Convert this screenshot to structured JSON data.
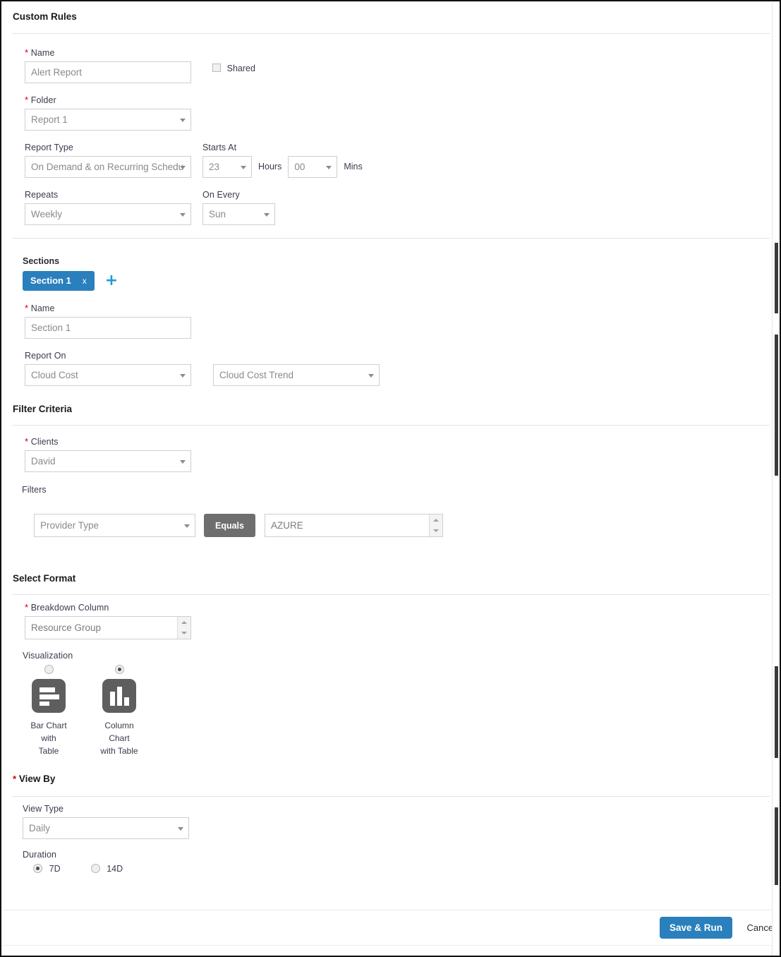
{
  "header": {
    "title": "Custom Rules"
  },
  "rule": {
    "name_label": "Name",
    "name_value": "Alert Report",
    "shared_label": "Shared",
    "shared_checked": false,
    "folder_label": "Folder",
    "folder_value": "Report 1",
    "report_type_label": "Report Type",
    "report_type_value": "On Demand & on Recurring Schedu",
    "starts_at_label": "Starts At",
    "hours_value": "23",
    "hours_unit": "Hours",
    "mins_value": "00",
    "mins_unit": "Mins",
    "repeats_label": "Repeats",
    "repeats_value": "Weekly",
    "on_every_label": "On Every",
    "on_every_value": "Sun"
  },
  "sections": {
    "label": "Sections",
    "tab_label": "Section 1",
    "tab_close": "x",
    "add_label": "+",
    "name_label": "Name",
    "name_value": "Section 1",
    "report_on_label": "Report On",
    "report_on_value": "Cloud Cost",
    "report_on_sub_value": "Cloud Cost Trend"
  },
  "filter_criteria": {
    "title": "Filter Criteria",
    "clients_label": "Clients",
    "clients_value": "David",
    "filters_label": "Filters",
    "filter_field_value": "Provider Type",
    "operator_label": "Equals",
    "filter_value": "AZURE"
  },
  "select_format": {
    "title": "Select Format",
    "breakdown_label": "Breakdown Column",
    "breakdown_value": "Resource Group",
    "visualization_label": "Visualization",
    "options": [
      {
        "caption_line1": "Bar Chart with",
        "caption_line2": "Table",
        "selected": false
      },
      {
        "caption_line1": "Column Chart",
        "caption_line2": "with Table",
        "selected": true
      }
    ]
  },
  "view_by": {
    "title": "View By",
    "view_type_label": "View Type",
    "view_type_value": "Daily",
    "duration_label": "Duration",
    "durations": [
      {
        "label": "7D",
        "selected": true
      },
      {
        "label": "14D",
        "selected": false
      }
    ]
  },
  "footer": {
    "save_label": "Save & Run",
    "cancel_label": "Cancel"
  },
  "colors": {
    "accent_blue": "#2a7fbd",
    "plus_blue": "#1f9ad6",
    "operator_gray": "#6e6e6e",
    "required_red": "#cc0000"
  }
}
